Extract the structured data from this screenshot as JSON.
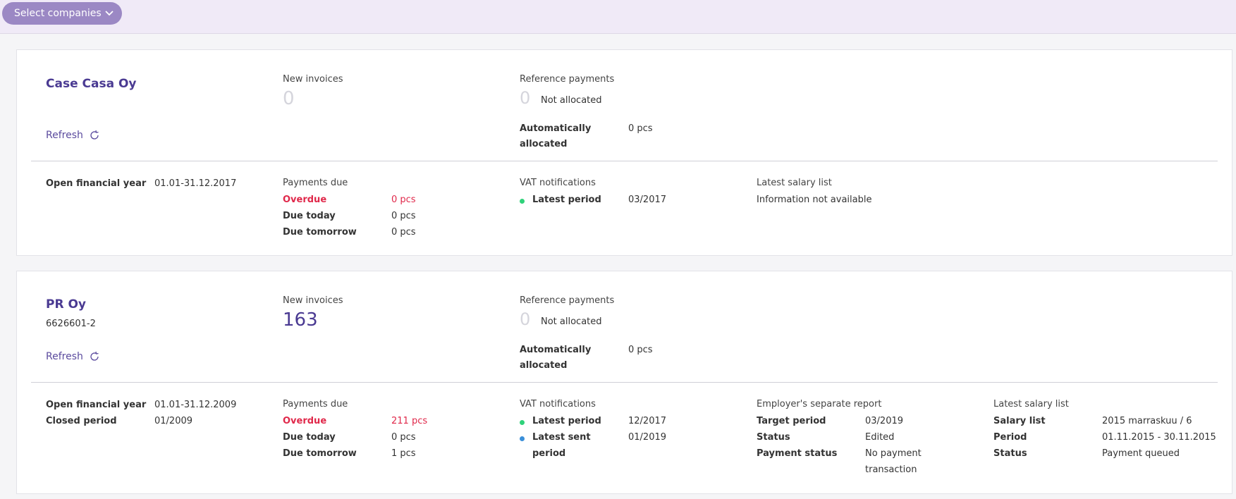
{
  "topbar": {
    "select_label": "Select companies"
  },
  "companies": [
    {
      "name": "Case Casa Oy",
      "business_id": "",
      "refresh_label": "Refresh",
      "new_invoices": {
        "label": "New invoices",
        "value": "0"
      },
      "reference_payments": {
        "label": "Reference payments",
        "not_allocated_value": "0",
        "not_allocated_label": "Not allocated",
        "auto_label_1": "Automatically",
        "auto_label_2": "allocated",
        "auto_value": "0 pcs"
      },
      "financial": {
        "open_label": "Open financial year",
        "open_value": "01.01-31.12.2017"
      },
      "payments_due": {
        "label": "Payments due",
        "overdue_label": "Overdue",
        "overdue_value": "0 pcs",
        "today_label": "Due today",
        "today_value": "0 pcs",
        "tomorrow_label": "Due tomorrow",
        "tomorrow_value": "0 pcs"
      },
      "vat": {
        "label": "VAT notifications",
        "latest_label": "Latest period",
        "latest_value": "03/2017"
      },
      "salary": {
        "label": "Latest salary list",
        "info": "Information not available"
      }
    },
    {
      "name": "PR Oy",
      "business_id": "6626601-2",
      "refresh_label": "Refresh",
      "new_invoices": {
        "label": "New invoices",
        "value": "163"
      },
      "reference_payments": {
        "label": "Reference payments",
        "not_allocated_value": "0",
        "not_allocated_label": "Not allocated",
        "auto_label_1": "Automatically",
        "auto_label_2": "allocated",
        "auto_value": "0 pcs"
      },
      "financial": {
        "open_label": "Open financial year",
        "open_value": "01.01-31.12.2009",
        "closed_label": "Closed period",
        "closed_value": "01/2009"
      },
      "payments_due": {
        "label": "Payments due",
        "overdue_label": "Overdue",
        "overdue_value": "211 pcs",
        "today_label": "Due today",
        "today_value": "0 pcs",
        "tomorrow_label": "Due tomorrow",
        "tomorrow_value": "1 pcs"
      },
      "vat": {
        "label": "VAT notifications",
        "latest_label": "Latest period",
        "latest_value": "12/2017",
        "sent_label_1": "Latest sent",
        "sent_label_2": "period",
        "sent_value": "01/2019"
      },
      "employer": {
        "label": "Employer's separate report",
        "target_label": "Target period",
        "target_value": "03/2019",
        "status_label": "Status",
        "status_value": "Edited",
        "payment_label": "Payment status",
        "payment_value_1": "No payment",
        "payment_value_2": "transaction"
      },
      "salary": {
        "label": "Latest salary list",
        "list_label": "Salary list",
        "list_value": "2015 marraskuu / 6",
        "period_label": "Period",
        "period_value": "01.11.2015 - 30.11.2015",
        "status_label": "Status",
        "status_value": "Payment queued"
      }
    }
  ],
  "colors": {
    "accent": "#4a3a92",
    "button": "#9b88c4",
    "overdue": "#e0284a",
    "dot_green": "#2fd27a",
    "dot_blue": "#3a8fd9"
  },
  "icons": {
    "select_chevron": "chevron-down-icon",
    "refresh": "refresh-icon"
  }
}
